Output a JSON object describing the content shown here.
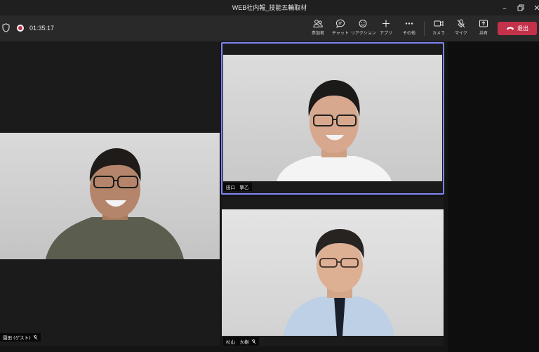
{
  "window": {
    "title": "WEB社内報_技能五輪取材"
  },
  "call": {
    "timer": "01:35:17"
  },
  "toolbar": {
    "participants": "参加者",
    "chat": "チャット",
    "reactions": "リアクション",
    "apps": "アプリ",
    "more": "その他",
    "camera": "カメラ",
    "mic": "マイク",
    "share": "共有",
    "leave": "退出"
  },
  "participants": [
    {
      "name": "園田 (ゲスト)",
      "muted": true
    },
    {
      "name": "田口　擎乙",
      "muted": false,
      "active_speaker": true
    },
    {
      "name": "杉山　大樹",
      "muted": true
    }
  ],
  "colors": {
    "accent": "#7f85f5",
    "leave": "#c4314b",
    "toolbar": "#292929"
  }
}
